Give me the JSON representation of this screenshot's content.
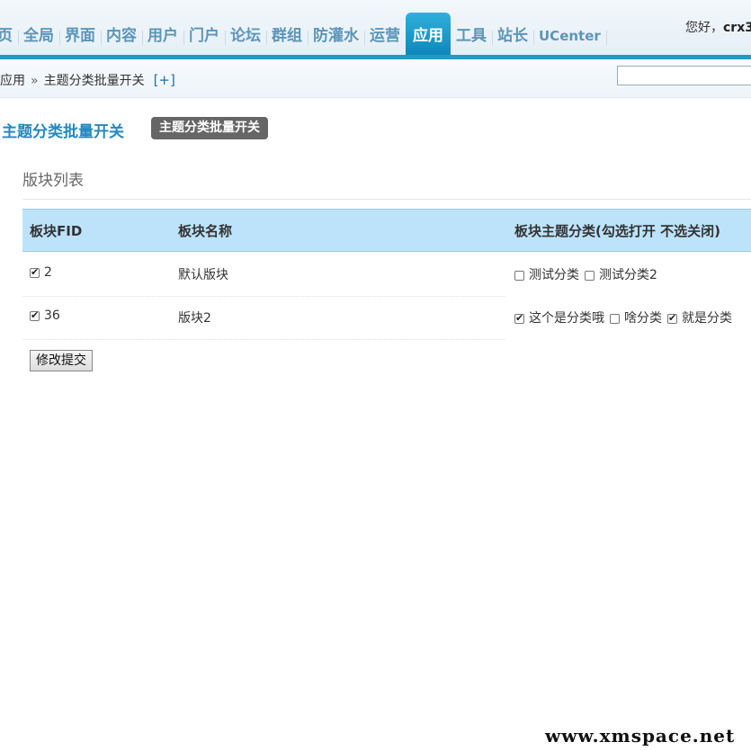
{
  "nav": {
    "items": [
      "页",
      "全局",
      "界面",
      "内容",
      "用户",
      "门户",
      "论坛",
      "群组",
      "防灌水",
      "运营",
      "应用",
      "工具",
      "站长",
      "UCenter"
    ],
    "active_index": 10
  },
  "header": {
    "greeting_prefix": "您好，",
    "username": "crx3"
  },
  "breadcrumb": {
    "items": [
      "应用",
      "主题分类批量开关"
    ],
    "separator": "»",
    "add_label": "[+]"
  },
  "search": {
    "value": ""
  },
  "page": {
    "title": "主题分类批量开关",
    "tab_label": "主题分类批量开关"
  },
  "section": {
    "title": "版块列表"
  },
  "table": {
    "headers": [
      "板块FID",
      "板块名称",
      "板块主题分类(勾选打开 不选关闭)"
    ],
    "rows": [
      {
        "fid": "2",
        "checked": true,
        "name": "默认版块",
        "options": [
          {
            "label": "测试分类",
            "checked": false
          },
          {
            "label": "测试分类2",
            "checked": false
          }
        ]
      },
      {
        "fid": "36",
        "checked": true,
        "name": "版块2",
        "options": [
          {
            "label": "这个是分类哦",
            "checked": true
          },
          {
            "label": "啥分类",
            "checked": false
          },
          {
            "label": "就是分类",
            "checked": true
          }
        ]
      }
    ]
  },
  "submit": {
    "label": "修改提交"
  },
  "watermark": "www.xmspace.net",
  "colors": {
    "accent": "#1f9bc7",
    "header_bg": "#bde3fb",
    "title": "#2289bf"
  }
}
